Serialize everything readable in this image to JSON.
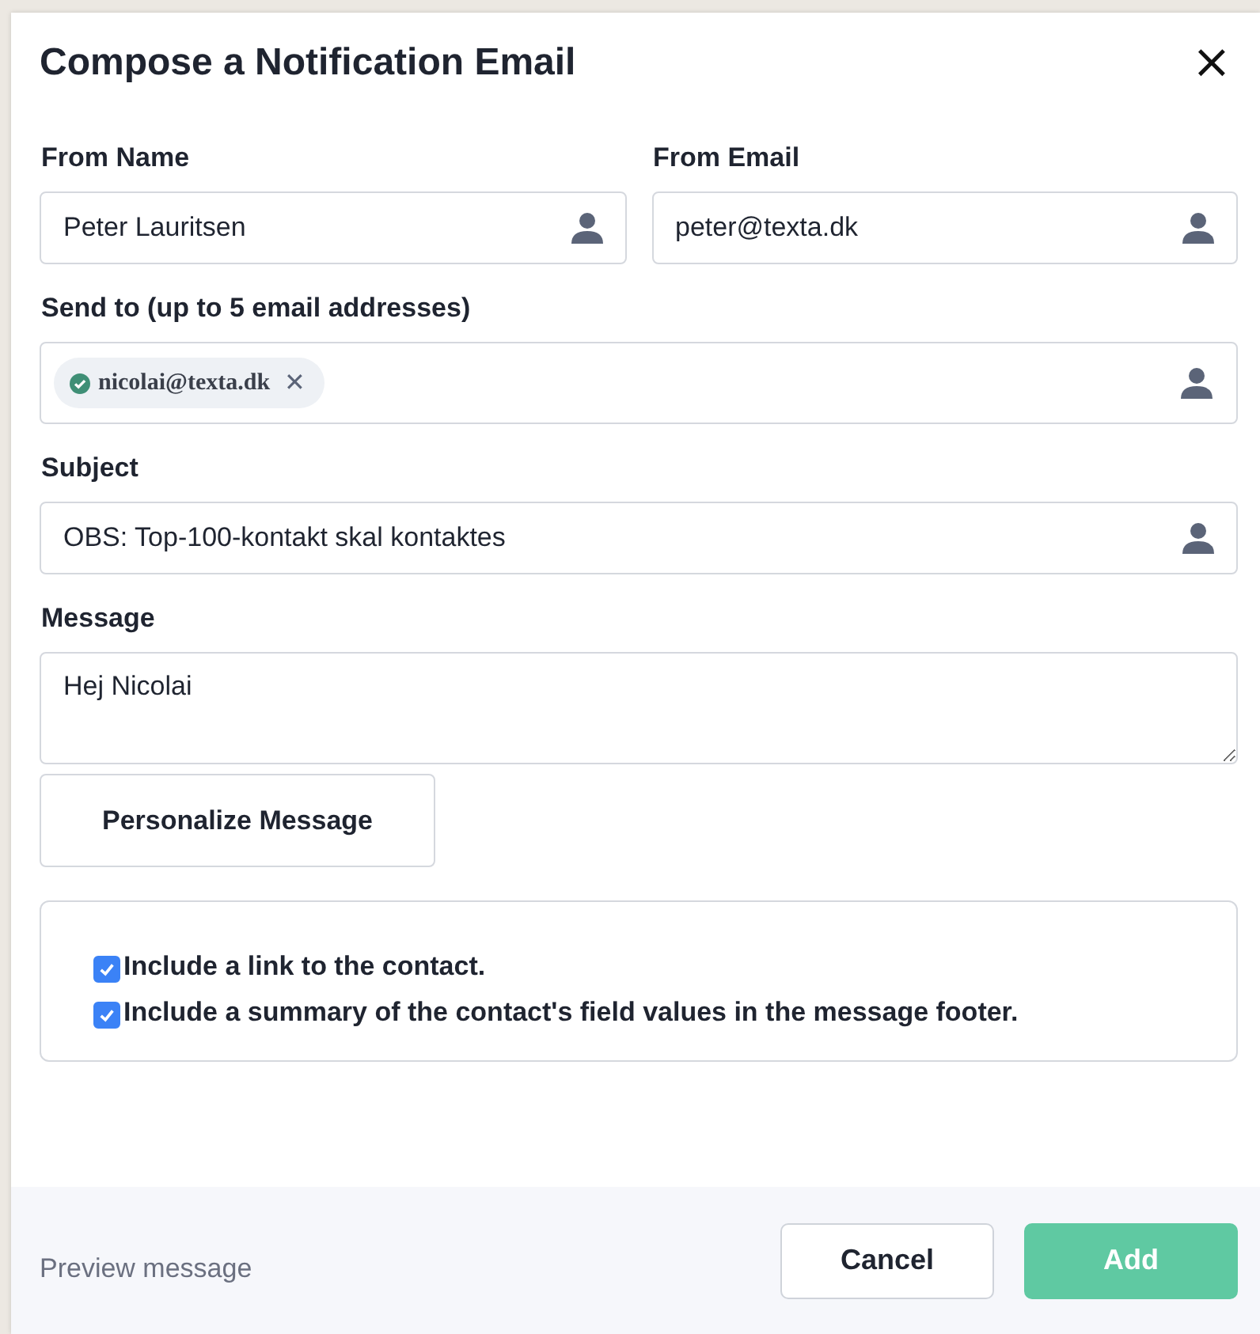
{
  "dialog": {
    "title": "Compose a Notification Email",
    "close": "×"
  },
  "from_name": {
    "label": "From Name",
    "value": "Peter Lauritsen"
  },
  "from_email": {
    "label": "From Email",
    "value": "peter@texta.dk"
  },
  "send_to": {
    "label": "Send to (up to 5 email addresses)",
    "chips": [
      {
        "text": "nicolai@texta.dk",
        "remove": "✕"
      }
    ]
  },
  "subject": {
    "label": "Subject",
    "value": "OBS: Top-100-kontakt skal kontaktes"
  },
  "message": {
    "label": "Message",
    "value": "Hej Nicolai"
  },
  "personalize_button": "Personalize Message",
  "options": [
    {
      "label": "Include a link to the contact.",
      "checked": true
    },
    {
      "label": "Include a summary of the contact's field values in the message footer.",
      "checked": true
    }
  ],
  "footer": {
    "preview_link": "Preview message",
    "buttons": [
      {
        "label": "Cancel",
        "kind": "secondary"
      },
      {
        "label": "Add",
        "kind": "primary"
      }
    ]
  }
}
